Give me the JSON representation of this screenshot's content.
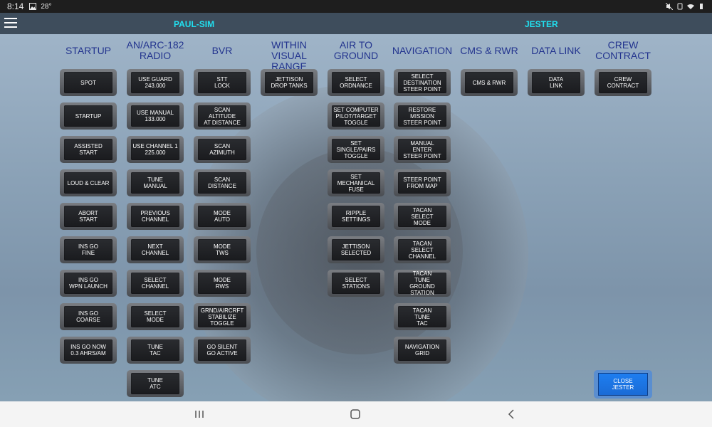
{
  "status_bar": {
    "time": "8:14",
    "temperature": "28°"
  },
  "header": {
    "left_name": "PAUL-SIM",
    "right_name": "JESTER"
  },
  "columns": [
    {
      "title": "STARTUP",
      "buttons": [
        "SPOT",
        "STARTUP",
        "ASSISTED\nSTART",
        "LOUD & CLEAR",
        "ABORT\nSTART",
        "INS GO\nFINE",
        "INS GO\nWPN LAUNCH",
        "INS GO\nCOARSE",
        "INS GO NOW\n0.3 AHRS/AM"
      ]
    },
    {
      "title": "AN/ARC-182\nRADIO",
      "buttons": [
        "USE GUARD\n243.000",
        "USE MANUAL\n133.000",
        "USE CHANNEL 1\n225.000",
        "TUNE\nMANUAL",
        "PREVIOUS\nCHANNEL",
        "NEXT\nCHANNEL",
        "SELECT\nCHANNEL",
        "SELECT\nMODE",
        "TUNE\nTAC",
        "TUNE\nATC"
      ]
    },
    {
      "title": "BVR",
      "buttons": [
        "STT\nLOCK",
        "SCAN\nALTITUDE\nAT DISTANCE",
        "SCAN\nAZIMUTH",
        "SCAN\nDISTANCE",
        "MODE\nAUTO",
        "MODE\nTWS",
        "MODE\nRWS",
        "GRND/AIRCRFT\nSTABILIZE\nTOGGLE",
        "GO SILENT\nGO ACTIVE"
      ]
    },
    {
      "title": "WITHIN\nVISUAL RANGE",
      "buttons": [
        "JETTISON\nDROP TANKS"
      ]
    },
    {
      "title": "AIR TO\nGROUND",
      "buttons": [
        "SELECT\nORDNANCE",
        "SET COMPUTER\nPILOT/TARGET\nTOGGLE",
        "SET\nSINGLE/PAIRS\nTOGGLE",
        "SET\nMECHANICAL\nFUSE",
        "RIPPLE\nSETTINGS",
        "JETTISON\nSELECTED",
        "SELECT\nSTATIONS"
      ]
    },
    {
      "title": "NAVIGATION",
      "buttons": [
        "SELECT\nDESTINATION\nSTEER POINT",
        "RESTORE\nMISSION\nSTEER POINT",
        "MANUAL\nENTER\nSTEER POINT",
        "STEER POINT\nFROM MAP",
        "TACAN\nSELECT\nMODE",
        "TACAN\nSELECT\nCHANNEL",
        "TACAN\nTUNE\nGROUND STATION",
        "TACAN\nTUNE\nTAC",
        "NAVIGATION\nGRID"
      ]
    },
    {
      "title": "CMS & RWR",
      "buttons": [
        "CMS & RWR"
      ]
    },
    {
      "title": "DATA LINK",
      "buttons": [
        "DATA\nLINK"
      ]
    },
    {
      "title": "CREW\nCONTRACT",
      "buttons": [
        "CREW\nCONTRACT"
      ]
    }
  ],
  "close_button": "CLOSE\nJESTER",
  "icons": {
    "menu": "hamburger-menu-icon",
    "recents": "recents-icon",
    "home": "home-icon",
    "back": "back-icon"
  },
  "colors": {
    "header_bg": "#3e4d5c",
    "header_name": "#21e0f0",
    "column_title": "#22338e",
    "close_button": "#1e7ef0"
  }
}
